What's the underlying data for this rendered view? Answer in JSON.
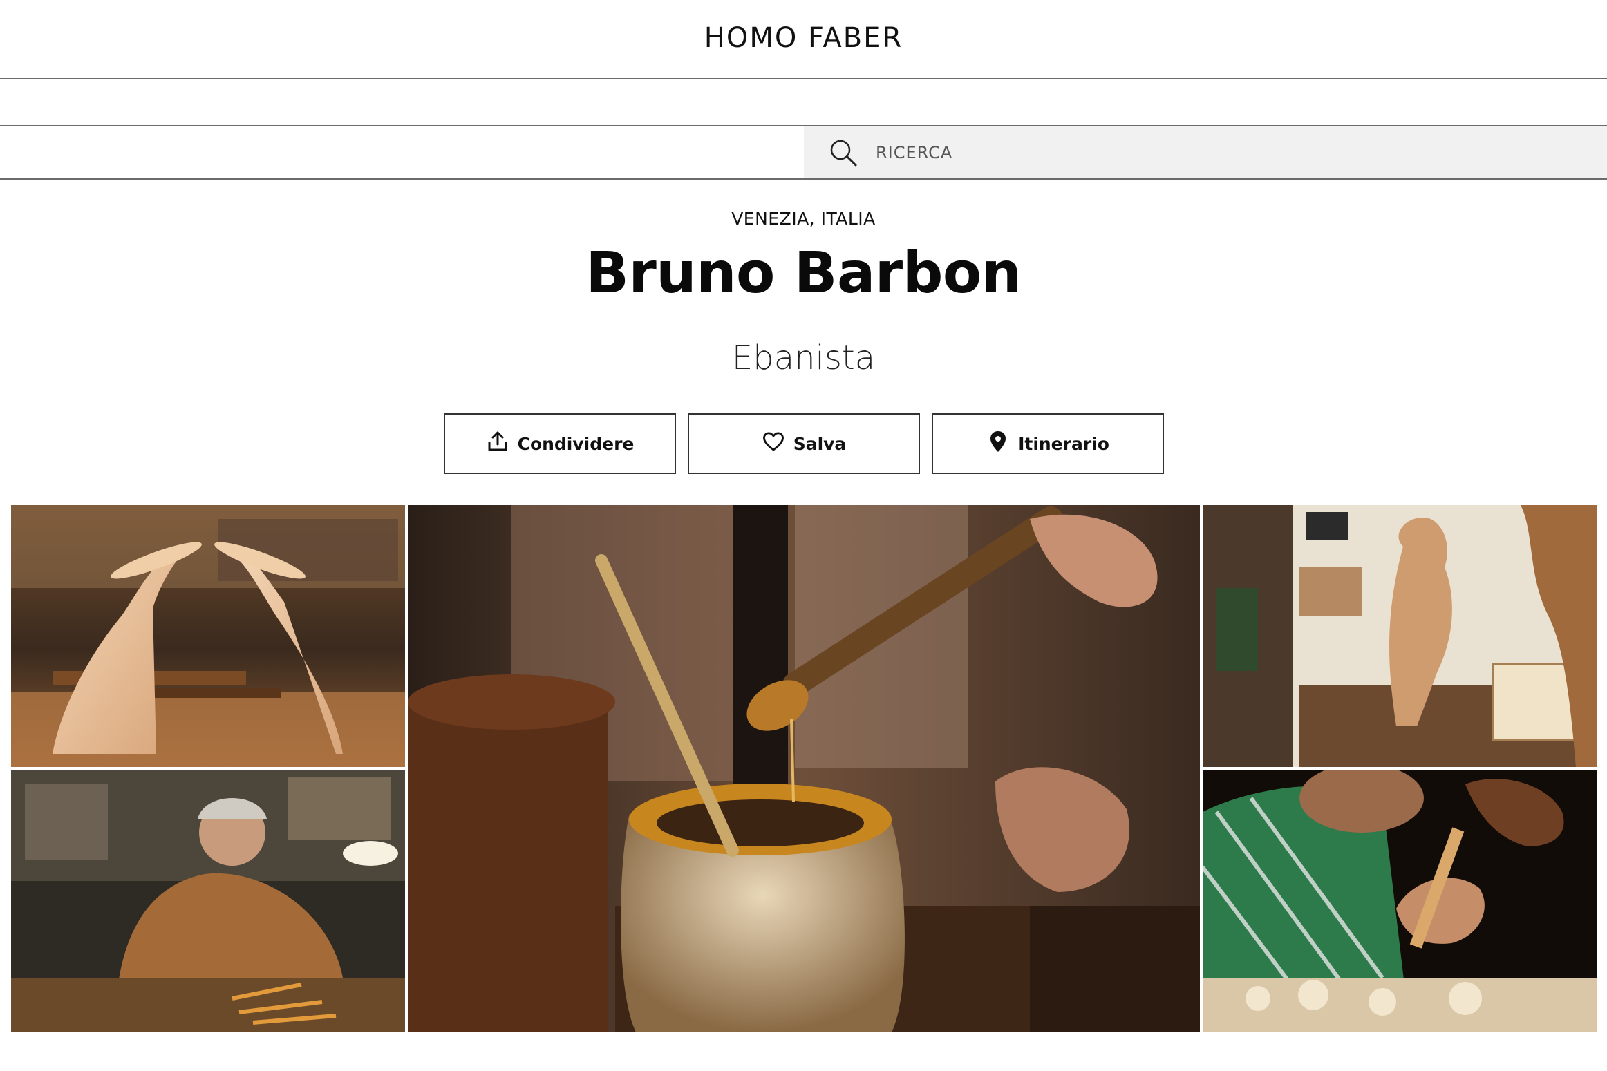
{
  "header": {
    "logo_text": "HOMO FABER"
  },
  "search": {
    "placeholder": "RICERCA",
    "icon": "search-icon"
  },
  "profile": {
    "location": "VENEZIA, ITALIA",
    "name": "Bruno Barbon",
    "profession": "Ebanista"
  },
  "actions": [
    {
      "label": "Condividere",
      "icon": "share-icon"
    },
    {
      "label": "Salva",
      "icon": "heart-icon"
    },
    {
      "label": "Itinerario",
      "icon": "location-pin-icon"
    }
  ],
  "gallery": {
    "images": [
      {
        "subject": "carved wooden hands on workbench"
      },
      {
        "subject": "artisan carving at workbench"
      },
      {
        "subject": "brush dipped in glue pot"
      },
      {
        "subject": "carved wooden figure in workshop"
      },
      {
        "subject": "artisan chiseling wood with mallet"
      }
    ]
  }
}
